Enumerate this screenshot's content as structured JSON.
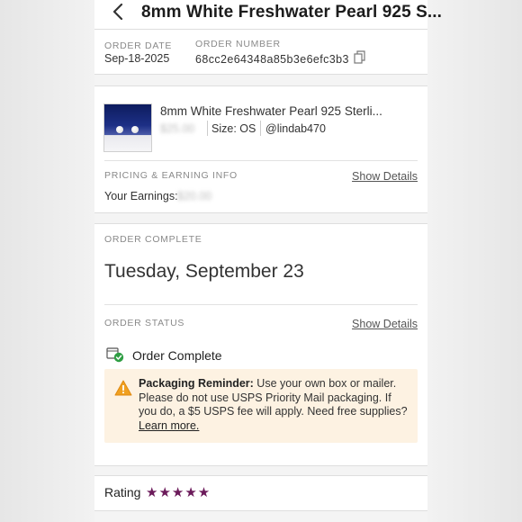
{
  "header": {
    "title": "8mm White Freshwater Pearl 925 S...",
    "back_icon": "chevron-left-icon"
  },
  "order": {
    "date_label": "ORDER DATE",
    "date_value": "Sep-18-2025",
    "number_label": "ORDER NUMBER",
    "number_value": "68cc2e64348a85b3e6efc3b3",
    "copy_icon": "copy-icon"
  },
  "item": {
    "title": "8mm White Freshwater Pearl 925 Sterli...",
    "price": "$25.00",
    "size": "Size: OS",
    "seller": "@lindab470"
  },
  "pricing": {
    "label": "PRICING & EARNING INFO",
    "link": "Show Details",
    "earnings_label": "Your Earnings:",
    "earnings_value": "$20.00"
  },
  "complete": {
    "label": "ORDER COMPLETE",
    "date": "Tuesday, September 23"
  },
  "status": {
    "label": "ORDER STATUS",
    "link": "Show Details",
    "title": "Order Complete",
    "icon": "package-check-icon"
  },
  "reminder": {
    "icon": "warning-icon",
    "heading": "Packaging Reminder:",
    "body": " Use your own box or mailer. Please do not use USPS Priority Mail packaging. If you do, a $5 USPS fee will apply. Need free supplies? ",
    "link": "Learn more."
  },
  "rating": {
    "label": "Rating",
    "stars": "★★★★★",
    "value": 5,
    "color": "#6b1a5a"
  }
}
